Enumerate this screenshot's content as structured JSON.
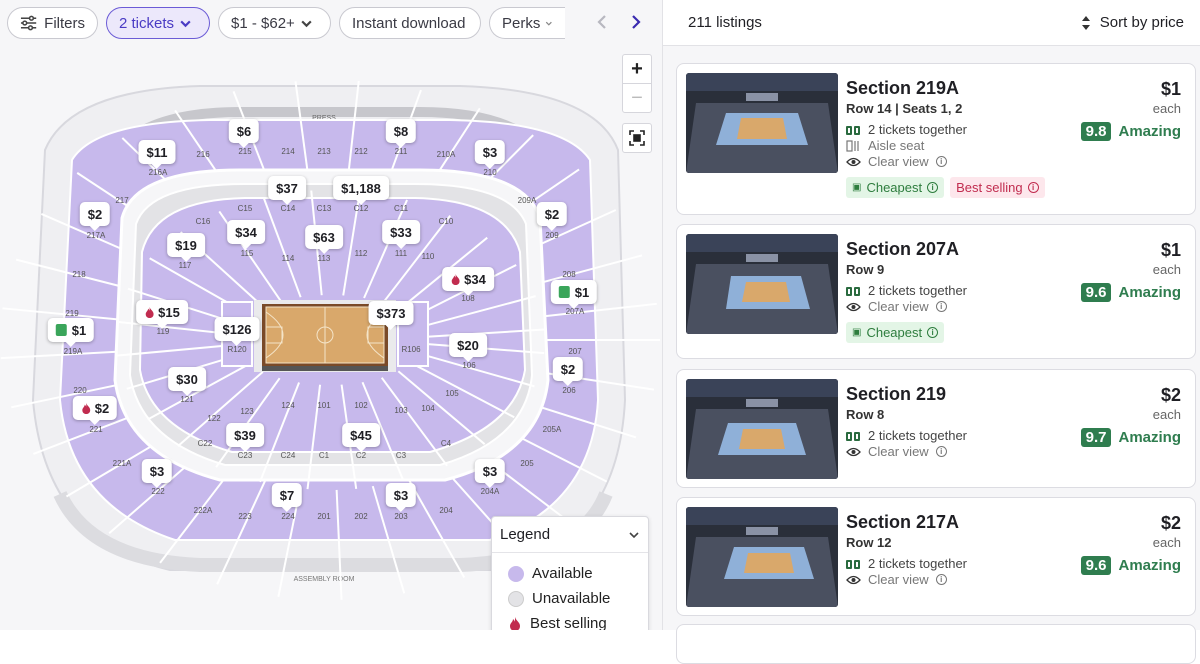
{
  "filters": {
    "filters_label": "Filters",
    "tickets_label": "2 tickets",
    "price_label": "$1 - $62+",
    "instant_label": "Instant download",
    "perks_label": "Perks"
  },
  "map": {
    "press_label": "PRESS",
    "assembly_label": "ASSEMBLY ROOM",
    "zoom_in": "+",
    "zoom_out": "−",
    "section_labels": [
      "216",
      "215",
      "214",
      "213",
      "212",
      "211",
      "210A",
      "216A",
      "210",
      "217",
      "209A",
      "217A",
      "209",
      "218",
      "208",
      "219",
      "207A",
      "219A",
      "207",
      "220",
      "206",
      "221",
      "205A",
      "221A",
      "205",
      "222",
      "204A",
      "222A",
      "223",
      "224",
      "201",
      "202",
      "203",
      "204",
      "C15",
      "C14",
      "C13",
      "C12",
      "C11",
      "C10",
      "C16",
      "117",
      "115",
      "114",
      "113",
      "112",
      "111",
      "110",
      "109",
      "108",
      "119",
      "R120",
      "R106",
      "106",
      "121",
      "105",
      "122",
      "104",
      "123",
      "124",
      "101",
      "102",
      "103",
      "C22",
      "C23",
      "C24",
      "C1",
      "C2",
      "C3",
      "C4"
    ],
    "pins": [
      {
        "price": "$6",
        "icon": ""
      },
      {
        "price": "$8",
        "icon": ""
      },
      {
        "price": "$11",
        "icon": ""
      },
      {
        "price": "$3",
        "icon": ""
      },
      {
        "price": "$37",
        "icon": ""
      },
      {
        "price": "$1,188",
        "icon": ""
      },
      {
        "price": "$2",
        "icon": ""
      },
      {
        "price": "$2",
        "icon": ""
      },
      {
        "price": "$19",
        "icon": ""
      },
      {
        "price": "$34",
        "icon": ""
      },
      {
        "price": "$63",
        "icon": ""
      },
      {
        "price": "$33",
        "icon": ""
      },
      {
        "price": "$34",
        "icon": "fire"
      },
      {
        "price": "$1",
        "icon": "ticket"
      },
      {
        "price": "$15",
        "icon": "fire"
      },
      {
        "price": "$1",
        "icon": "ticket"
      },
      {
        "price": "$126",
        "icon": ""
      },
      {
        "price": "$373",
        "icon": ""
      },
      {
        "price": "$20",
        "icon": ""
      },
      {
        "price": "$30",
        "icon": ""
      },
      {
        "price": "$2",
        "icon": ""
      },
      {
        "price": "$2",
        "icon": "fire"
      },
      {
        "price": "$39",
        "icon": ""
      },
      {
        "price": "$45",
        "icon": ""
      },
      {
        "price": "$3",
        "icon": ""
      },
      {
        "price": "$3",
        "icon": ""
      },
      {
        "price": "$7",
        "icon": ""
      },
      {
        "price": "$3",
        "icon": ""
      }
    ]
  },
  "legend": {
    "title": "Legend",
    "available": "Available",
    "unavailable": "Unavailable",
    "best_selling": "Best selling",
    "available_color": "#c7b9ec",
    "unavailable_color": "#e3e3e6"
  },
  "listings": {
    "count_label": "211 listings",
    "sort_label": "Sort by price",
    "cards": [
      {
        "section": "Section 219A",
        "row": "Row 14 | Seats 1, 2",
        "price": "$1",
        "each": "each",
        "score": "9.8",
        "rating": "Amazing",
        "together": "2 tickets together",
        "aisle": "Aisle seat",
        "view": "Clear view",
        "cheapest": "Cheapest",
        "best": "Best selling"
      },
      {
        "section": "Section 207A",
        "row": "Row 9",
        "price": "$1",
        "each": "each",
        "score": "9.6",
        "rating": "Amazing",
        "together": "2 tickets together",
        "view": "Clear view",
        "cheapest": "Cheapest"
      },
      {
        "section": "Section 219",
        "row": "Row 8",
        "price": "$2",
        "each": "each",
        "score": "9.7",
        "rating": "Amazing",
        "together": "2 tickets together",
        "view": "Clear view"
      },
      {
        "section": "Section 217A",
        "row": "Row 12",
        "price": "$2",
        "each": "each",
        "score": "9.6",
        "rating": "Amazing",
        "together": "2 tickets together",
        "view": "Clear view"
      }
    ]
  }
}
